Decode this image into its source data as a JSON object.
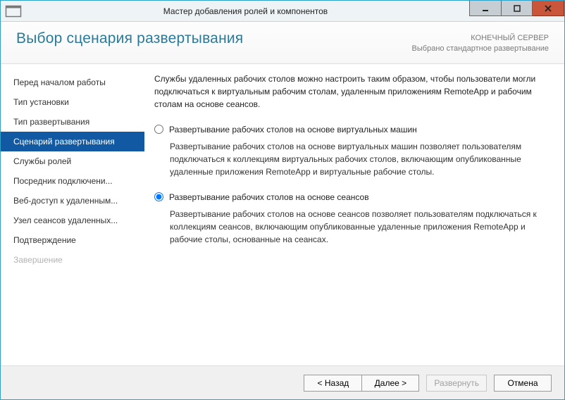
{
  "titlebar": {
    "title": "Мастер добавления ролей и компонентов"
  },
  "header": {
    "heading": "Выбор сценария развертывания",
    "server_label": "КОНЕЧНЫЙ СЕРВЕР",
    "deployment_label": "Выбрано стандартное развертывание"
  },
  "sidebar": {
    "items": [
      {
        "label": "Перед началом работы",
        "state": "normal"
      },
      {
        "label": "Тип установки",
        "state": "normal"
      },
      {
        "label": "Тип развертывания",
        "state": "normal"
      },
      {
        "label": "Сценарий развертывания",
        "state": "active"
      },
      {
        "label": "Службы ролей",
        "state": "normal"
      },
      {
        "label": "Посредник подключени...",
        "state": "normal"
      },
      {
        "label": "Веб-доступ к удаленным...",
        "state": "normal"
      },
      {
        "label": "Узел сеансов удаленных...",
        "state": "normal"
      },
      {
        "label": "Подтверждение",
        "state": "normal"
      },
      {
        "label": "Завершение",
        "state": "disabled"
      }
    ]
  },
  "content": {
    "description": "Службы удаленных рабочих столов можно настроить таким образом, чтобы пользователи могли подключаться к виртуальным рабочим столам, удаленным приложениям RemoteApp и рабочим столам на основе сеансов.",
    "options": [
      {
        "label": "Развертывание рабочих столов на основе виртуальных машин",
        "desc": "Развертывание рабочих столов на основе виртуальных машин позволяет пользователям подключаться к коллекциям виртуальных рабочих столов, включающим опубликованные удаленные приложения RemoteApp и виртуальные рабочие столы.",
        "checked": false
      },
      {
        "label": "Развертывание рабочих столов на основе сеансов",
        "desc": "Развертывание рабочих столов на основе сеансов позволяет пользователям подключаться к коллекциям сеансов, включающим опубликованные удаленные приложения RemoteApp и рабочие столы, основанные на сеансах.",
        "checked": true
      }
    ]
  },
  "footer": {
    "back": "< Назад",
    "next": "Далее >",
    "deploy": "Развернуть",
    "cancel": "Отмена"
  }
}
